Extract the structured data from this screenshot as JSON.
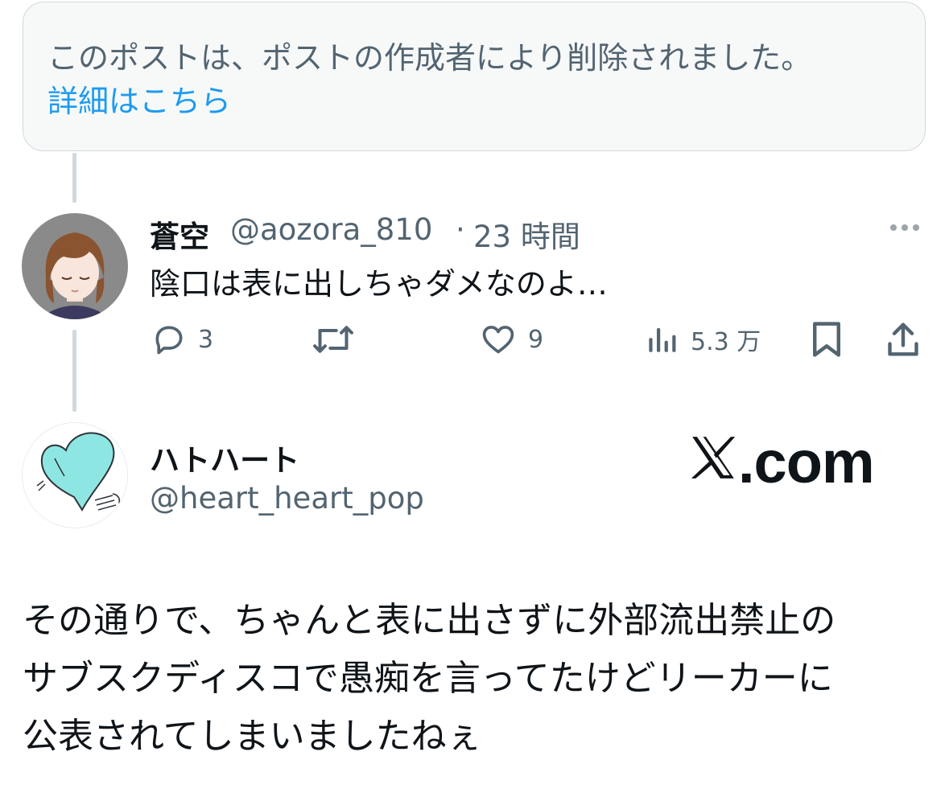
{
  "deleted_notice": {
    "text": "このポストは、ポストの作成者により削除されました。",
    "link": "詳細はこちら"
  },
  "reply": {
    "author_name": "蒼空",
    "handle": "@aozora_810",
    "separator": "·",
    "time": "23 時間",
    "text": "陰口は表に出しちゃダメなのよ…",
    "more_icon": "more-dots-icon",
    "actions": {
      "reply_count": "3",
      "retweet_count": "",
      "like_count": "9",
      "views_count": "5.3 万"
    }
  },
  "main_post": {
    "author_name": "ハトハート",
    "handle": "@heart_heart_pop",
    "body_lines": [
      "その通りで、ちゃんと表に出さずに外部流出禁止の",
      "サブスクディスコで愚痴を言ってたけどリーカーに",
      "公表されてしまいましたねぇ"
    ]
  },
  "watermark": {
    "text": ".com"
  },
  "colors": {
    "secondary_text": "#536471",
    "link": "#1d9bf0",
    "border": "#cfd9de"
  }
}
